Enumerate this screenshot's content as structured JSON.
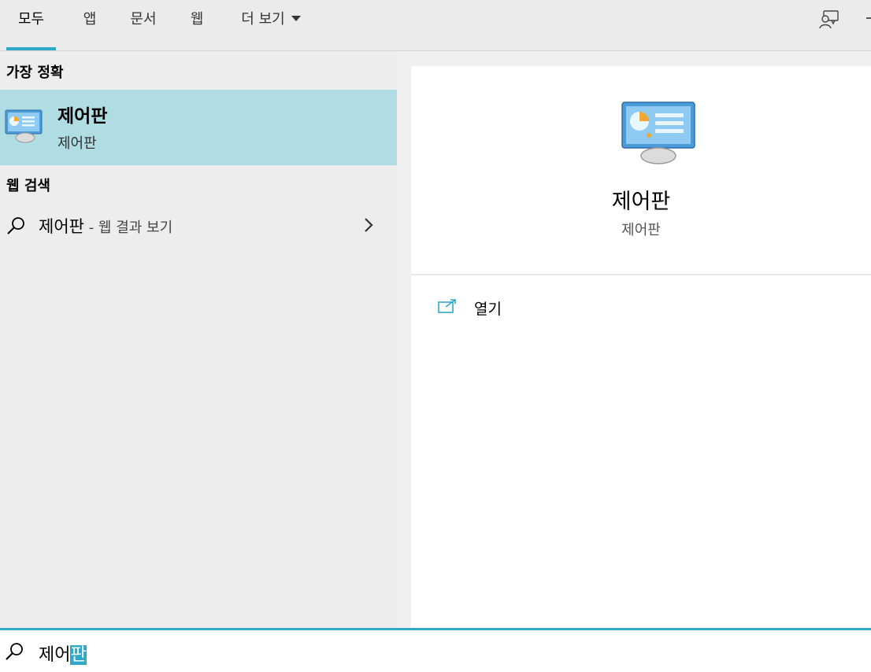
{
  "tabs": [
    {
      "label": "모두",
      "active": true
    },
    {
      "label": "앱"
    },
    {
      "label": "문서"
    },
    {
      "label": "웹"
    },
    {
      "label": "더 보기"
    }
  ],
  "best_match": {
    "heading": "가장 정확",
    "title": "제어판",
    "subtitle": "제어판"
  },
  "web_search": {
    "heading": "웹 검색",
    "query": "제어판",
    "suffix": " - 웹 결과 보기"
  },
  "preview": {
    "title": "제어판",
    "subtitle": "제어판",
    "action_label": "열기"
  },
  "search": {
    "text_normal": "제어",
    "text_selected": "판"
  },
  "colors": {
    "accent": "#30a8c8",
    "selected_bg": "#b0dce4"
  },
  "icons": {
    "feedback": "feedback-icon",
    "search": "search-icon",
    "open": "open-external-icon",
    "app": "control-panel-icon"
  }
}
